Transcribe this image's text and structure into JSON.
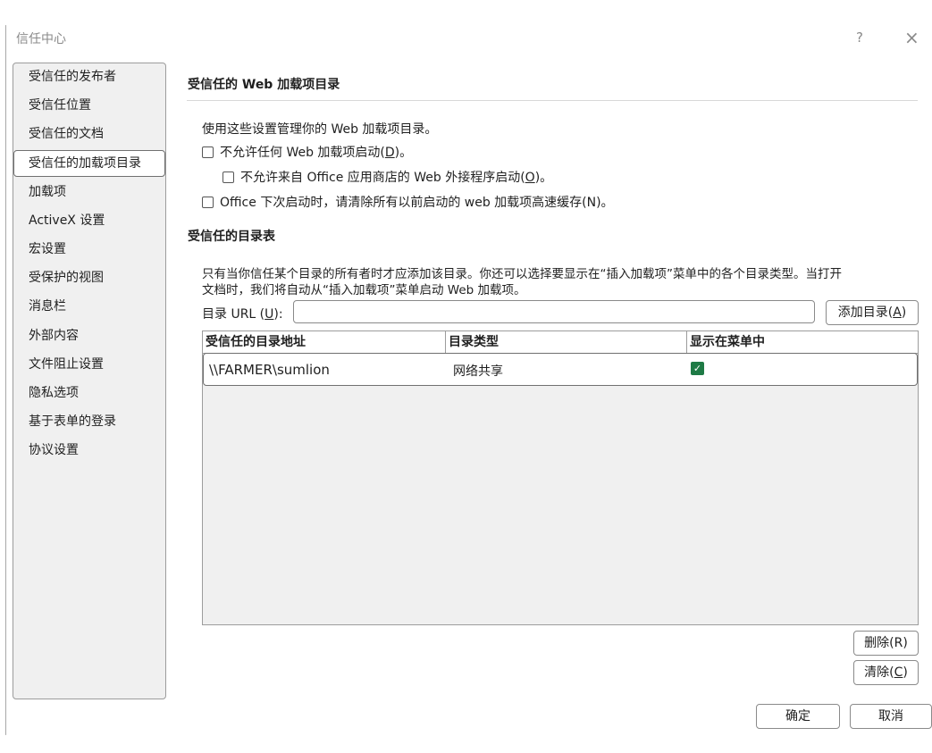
{
  "window": {
    "title": "信任中心",
    "help_label": "?",
    "close_label": "×"
  },
  "sidebar": {
    "items": [
      {
        "label": "受信任的发布者"
      },
      {
        "label": "受信任位置"
      },
      {
        "label": "受信任的文档"
      },
      {
        "label": "受信任的加载项目录"
      },
      {
        "label": "加载项"
      },
      {
        "label": "ActiveX 设置"
      },
      {
        "label": "宏设置"
      },
      {
        "label": "受保护的视图"
      },
      {
        "label": "消息栏"
      },
      {
        "label": "外部内容"
      },
      {
        "label": "文件阻止设置"
      },
      {
        "label": "隐私选项"
      },
      {
        "label": "基于表单的登录"
      },
      {
        "label": "协议设置"
      }
    ],
    "selected": "受信任的加载项目录"
  },
  "main": {
    "section1_title": "受信任的 Web 加载项目录",
    "intro": "使用这些设置管理你的 Web 加载项目录。",
    "opt1_pre": "不允许任何 Web 加载项启动(",
    "opt1_key": "D",
    "opt1_post": ")。",
    "opt2_pre": "不允许来自 Office 应用商店的 Web 外接程序启动(",
    "opt2_key": "O",
    "opt2_post": ")。",
    "opt3": "Office 下次启动时，请清除所有以前启动的 web 加载项高速缓存(N)。",
    "section2_title": "受信任的目录表",
    "desc_line1": "只有当你信任某个目录的所有者时才应添加该目录。你还可以选择要显示在“插入加载项”菜单中的各个目录类型。当打开",
    "desc_line2": "文档时，我们将自动从“插入加载项”菜单启动 Web 加载项。",
    "uri_label_pre": "目录 URL (",
    "uri_label_key": "U",
    "uri_label_post": "):",
    "uri_value": "",
    "add_pre": "添加目录(",
    "add_key": "A",
    "add_post": ")",
    "table": {
      "headers": [
        "受信任的目录地址",
        "目录类型",
        "显示在菜单中"
      ],
      "rows": [
        {
          "address": "\\\\FARMER\\sumlion",
          "type": "网络共享",
          "show_in_menu": true
        }
      ]
    },
    "remove_label": "删除(R)",
    "clear_pre": "清除(",
    "clear_key": "C",
    "clear_post": ")"
  },
  "footer": {
    "ok_label": "确定",
    "cancel_label": "取消"
  },
  "colors": {
    "accent_check": "#1e7a45",
    "panel_bg": "#f0f0f0"
  }
}
